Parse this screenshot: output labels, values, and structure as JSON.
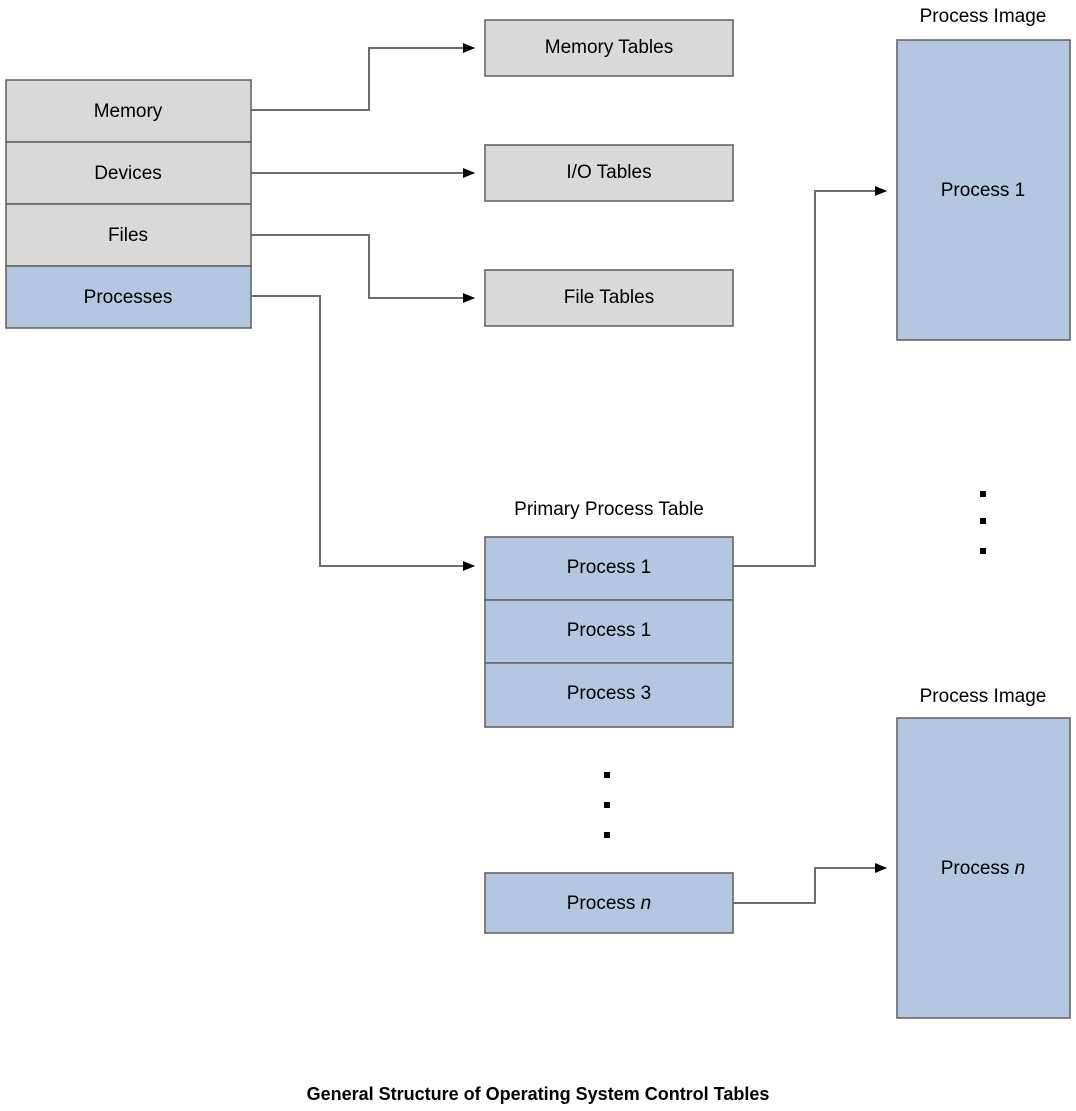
{
  "caption": "General Structure of Operating System Control Tables",
  "resource_stack": {
    "name": "resource-stack",
    "items": [
      {
        "label": "Memory",
        "kind": "gray"
      },
      {
        "label": "Devices",
        "kind": "gray"
      },
      {
        "label": "Files",
        "kind": "gray"
      },
      {
        "label": "Processes",
        "kind": "blue"
      }
    ]
  },
  "tables": [
    {
      "label": "Memory Tables"
    },
    {
      "label": "I/O Tables"
    },
    {
      "label": "File Tables"
    }
  ],
  "primary_process_table": {
    "title": "Primary Process Table",
    "rows": [
      {
        "label": "Process 1"
      },
      {
        "label": "Process 1"
      },
      {
        "label": "Process 3"
      }
    ],
    "ellipsis": "·",
    "last_row": {
      "prefix": "Process ",
      "italic": "n"
    }
  },
  "process_images": [
    {
      "title": "Process Image",
      "prefix": "Process ",
      "italic": "1"
    },
    {
      "title": "Process Image",
      "prefix": "Process ",
      "italic": "n"
    }
  ],
  "side_ellipsis": "·",
  "colors": {
    "gray_fill": "#d9d9d9",
    "blue_fill": "#b4c7e0",
    "stroke": "#666666",
    "connector": "#6d6d6d",
    "text": "#000000",
    "background": "#ffffff"
  }
}
